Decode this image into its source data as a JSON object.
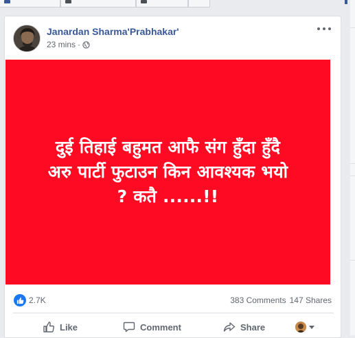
{
  "colors": {
    "post_background": "#ff0a23",
    "link_blue": "#385898",
    "like_blue": "#1877f2",
    "muted_text": "#606770"
  },
  "post": {
    "author": "Janardan Sharma'Prabhakar'",
    "time": "23 mins",
    "separator": "·",
    "privacy_icon": "globe-icon",
    "image_text_lines": [
      "दुई तिहाई बहुमत आफै संग हुँदा हुँदै",
      "अरु पार्टी फुटाउन किन आवश्यक भयो",
      "? कतै ......!!"
    ]
  },
  "stats": {
    "reactions": "2.7K",
    "comments": "383 Comments",
    "shares": "147 Shares"
  },
  "actions": {
    "like": "Like",
    "comment": "Comment",
    "share": "Share"
  }
}
